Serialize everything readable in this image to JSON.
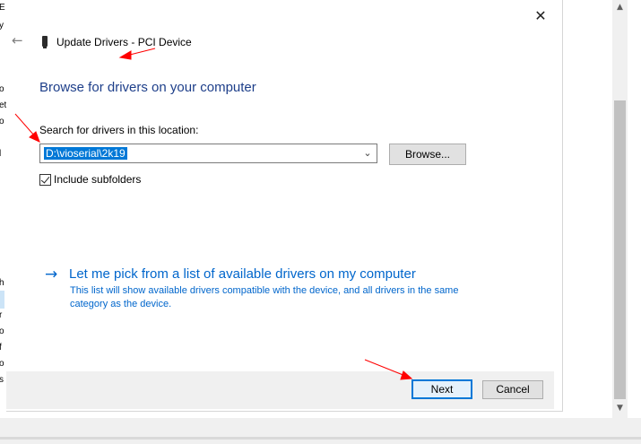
{
  "background_window": {
    "partial_letters": [
      "E",
      "y",
      "o",
      "o",
      "et",
      "l",
      "h",
      "r",
      "o",
      "f",
      "o",
      "s"
    ]
  },
  "dialog": {
    "title": "Update Drivers - PCI Device",
    "heading": "Browse for drivers on your computer",
    "location_label": "Search for drivers in this location:",
    "path_value": "D:\\vioserial\\2k19",
    "browse_label": "Browse...",
    "include_subfolders_label": "Include subfolders",
    "include_subfolders_checked": true,
    "pick_link": "Let me pick from a list of available drivers on my computer",
    "pick_description": "This list will show available drivers compatible with the device, and all drivers in the same category as the device.",
    "next_label": "Next",
    "cancel_label": "Cancel"
  },
  "icons": {
    "close": "close-icon",
    "back": "back-arrow-icon",
    "device": "pci-device-icon",
    "dropdown": "chevron-down-icon",
    "link_arrow": "right-arrow-icon"
  },
  "colors": {
    "heading": "#1e3f8a",
    "link": "#0066cc",
    "selection": "#0078d7",
    "annotation_arrow": "#ff0000"
  }
}
